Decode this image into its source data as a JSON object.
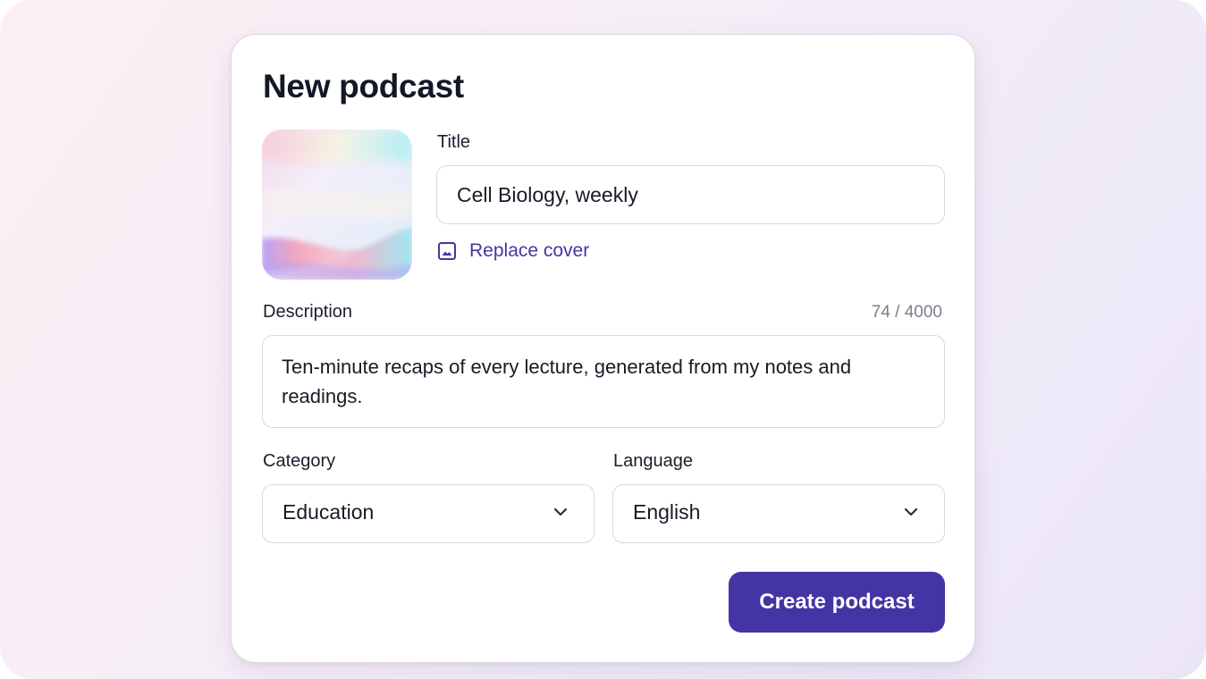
{
  "dialog": {
    "title": "New podcast",
    "cover_action_label": "Replace cover",
    "title_field": {
      "label": "Title",
      "value": "Cell Biology, weekly"
    },
    "description_field": {
      "label": "Description",
      "value": "Ten-minute recaps of every lecture, generated from my notes and readings.",
      "counter": "74 / 4000"
    },
    "category_field": {
      "label": "Category",
      "selected": "Education"
    },
    "language_field": {
      "label": "Language",
      "selected": "English"
    },
    "submit_label": "Create podcast"
  },
  "icons": {
    "cover_action": "image-icon",
    "dropdown": "chevron-down-icon"
  },
  "colors": {
    "accent": "#4435a4",
    "link": "#4436a3",
    "border": "#d8d8de",
    "text": "#161b26",
    "muted": "#7b7f89"
  }
}
